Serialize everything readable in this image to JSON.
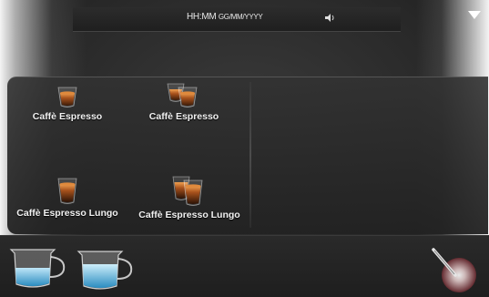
{
  "status_bar": {
    "time_format": "HH:MM",
    "date_format": "GG/MM/YYYY"
  },
  "products": [
    {
      "label": "Caffè Espresso",
      "icon": "espresso-cup-icon"
    },
    {
      "label": "Caffè Espresso",
      "icon": "double-espresso-cup-icon"
    },
    {
      "label": "Caffè Espresso Lungo",
      "icon": "lungo-cup-icon"
    },
    {
      "label": "Caffè Espresso Lungo",
      "icon": "double-lungo-cup-icon"
    }
  ],
  "bottom_bar": {
    "icons": [
      "milk-jug-icon",
      "milk-jug-icon",
      "steam-wand-icon"
    ]
  },
  "colors": {
    "coffee": "#a8521c",
    "crema": "#e08a3c",
    "milk_blue": "#4aa8d8"
  }
}
